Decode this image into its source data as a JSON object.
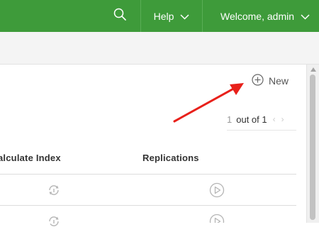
{
  "topbar": {
    "search_icon": "search-icon",
    "help_label": "Help",
    "welcome_label": "Welcome, admin",
    "bg_color": "#3e9b3a"
  },
  "toolbar": {
    "new_label": "New",
    "new_icon": "plus-circle-icon"
  },
  "pager": {
    "current": "1",
    "text": "out of 1",
    "prev_icon": "chevron-left-icon",
    "next_icon": "chevron-right-icon"
  },
  "table": {
    "columns": [
      "alculate Index",
      "Replications"
    ],
    "rows": [
      {
        "recalc_icon": "recalculate-icon",
        "replication_icon": "play-circle-icon"
      },
      {
        "recalc_icon": "recalculate-icon",
        "replication_icon": "play-circle-icon"
      }
    ]
  },
  "annotation": {
    "arrow_color": "#e8201a"
  }
}
